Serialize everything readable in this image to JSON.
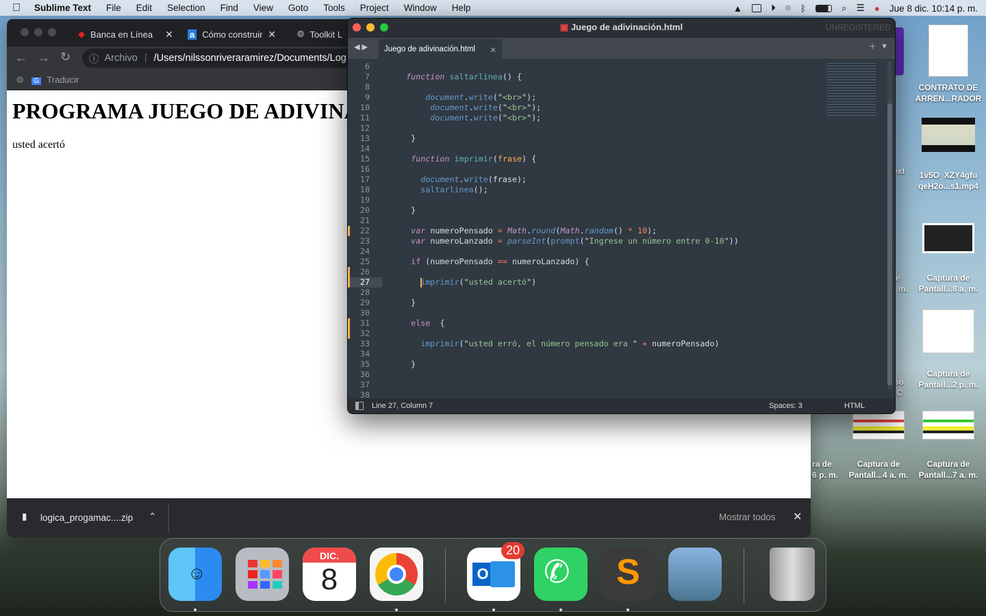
{
  "menubar": {
    "app": "Sublime Text",
    "items": [
      "File",
      "Edit",
      "Selection",
      "Find",
      "View",
      "Goto",
      "Tools",
      "Project",
      "Window",
      "Help"
    ],
    "clock": "Jue 8 dic.  10:14 p. m."
  },
  "chrome": {
    "tabs": [
      {
        "label": "Banca en Línea"
      },
      {
        "label": "Cómo construir u"
      },
      {
        "label": "Toolkit L"
      }
    ],
    "omnibox": {
      "scheme": "Archivo",
      "url": "/Users/nilssonriveraramirez/Documents/Log"
    },
    "bookmarks": [
      "Traducir"
    ],
    "page": {
      "heading": "PROGRAMA JUEGO DE ADIVINA",
      "text": "usted acertó"
    },
    "download": {
      "file": "logica_progamac....zip",
      "show_all": "Mostrar todos"
    }
  },
  "sublime": {
    "title": "Juego de adivinación.html",
    "unregistered": "UNREGISTERED",
    "tab": "Juego de adivinación.html",
    "current_line": 27,
    "status": {
      "position": "Line 27, Column 7",
      "spaces": "Spaces: 3",
      "syntax": "HTML"
    },
    "modified_lines": [
      22,
      26,
      27,
      31,
      32
    ],
    "lines": [
      {
        "n": 6,
        "t": []
      },
      {
        "n": 7,
        "t": [
          [
            "w",
            "   "
          ],
          [
            "k",
            "function"
          ],
          [
            "w",
            " "
          ],
          [
            "f",
            "saltarlinea"
          ],
          [
            "w",
            "() {"
          ]
        ]
      },
      {
        "n": 8,
        "t": []
      },
      {
        "n": 9,
        "t": [
          [
            "w",
            "       "
          ],
          [
            "lib",
            "document"
          ],
          [
            "w",
            "."
          ],
          [
            "m",
            "write"
          ],
          [
            "w",
            "(\""
          ],
          [
            "s",
            "<br>"
          ],
          [
            "w",
            "\");"
          ]
        ]
      },
      {
        "n": 10,
        "t": [
          [
            "w",
            "        "
          ],
          [
            "lib",
            "document"
          ],
          [
            "w",
            "."
          ],
          [
            "m",
            "write"
          ],
          [
            "w",
            "(\""
          ],
          [
            "s",
            "<br>"
          ],
          [
            "w",
            "\");"
          ]
        ]
      },
      {
        "n": 11,
        "t": [
          [
            "w",
            "        "
          ],
          [
            "lib",
            "document"
          ],
          [
            "w",
            "."
          ],
          [
            "m",
            "write"
          ],
          [
            "w",
            "(\""
          ],
          [
            "s",
            "<br>"
          ],
          [
            "w",
            "\");"
          ]
        ]
      },
      {
        "n": 12,
        "t": []
      },
      {
        "n": 13,
        "t": [
          [
            "w",
            "    }"
          ]
        ]
      },
      {
        "n": 14,
        "t": []
      },
      {
        "n": 15,
        "t": [
          [
            "w",
            "    "
          ],
          [
            "k",
            "function"
          ],
          [
            "w",
            " "
          ],
          [
            "f",
            "imprimir"
          ],
          [
            "w",
            "("
          ],
          [
            "p",
            "frase"
          ],
          [
            "w",
            ") {"
          ]
        ]
      },
      {
        "n": 16,
        "t": []
      },
      {
        "n": 17,
        "t": [
          [
            "w",
            "      "
          ],
          [
            "lib",
            "document"
          ],
          [
            "w",
            "."
          ],
          [
            "m",
            "write"
          ],
          [
            "w",
            "(frase);"
          ]
        ]
      },
      {
        "n": 18,
        "t": [
          [
            "w",
            "      "
          ],
          [
            "m",
            "saltarlinea"
          ],
          [
            "w",
            "();"
          ]
        ]
      },
      {
        "n": 19,
        "t": []
      },
      {
        "n": 20,
        "t": [
          [
            "w",
            "    }"
          ]
        ]
      },
      {
        "n": 21,
        "t": []
      },
      {
        "n": 22,
        "t": [
          [
            "w",
            "    "
          ],
          [
            "k",
            "var"
          ],
          [
            "w",
            " numeroPensado "
          ],
          [
            "o",
            "="
          ],
          [
            "w",
            " "
          ],
          [
            "k",
            "Math"
          ],
          [
            "w",
            "."
          ],
          [
            "lib",
            "round"
          ],
          [
            "w",
            "("
          ],
          [
            "k",
            "Math"
          ],
          [
            "w",
            "."
          ],
          [
            "lib",
            "random"
          ],
          [
            "w",
            "() "
          ],
          [
            "o",
            "*"
          ],
          [
            "w",
            " "
          ],
          [
            "n",
            "10"
          ],
          [
            "w",
            ");"
          ]
        ]
      },
      {
        "n": 23,
        "t": [
          [
            "w",
            "    "
          ],
          [
            "k",
            "var"
          ],
          [
            "w",
            " numeroLanzado "
          ],
          [
            "o",
            "="
          ],
          [
            "w",
            " "
          ],
          [
            "lib",
            "parseInt"
          ],
          [
            "w",
            "("
          ],
          [
            "m",
            "prompt"
          ],
          [
            "w",
            "(\""
          ],
          [
            "s",
            "Ingrese un número entre 0-10"
          ],
          [
            "w",
            "\"))"
          ]
        ]
      },
      {
        "n": 24,
        "t": []
      },
      {
        "n": 25,
        "t": [
          [
            "w",
            "    "
          ],
          [
            "kn",
            "if"
          ],
          [
            "w",
            " (numeroPensado "
          ],
          [
            "o",
            "=="
          ],
          [
            "w",
            " numeroLanzado) {"
          ]
        ]
      },
      {
        "n": 26,
        "t": []
      },
      {
        "n": 27,
        "t": [
          [
            "w",
            "      "
          ],
          [
            "m",
            "imprimir"
          ],
          [
            "w",
            "(\""
          ],
          [
            "s",
            "usted acertó"
          ],
          [
            "w",
            "\")"
          ]
        ]
      },
      {
        "n": 28,
        "t": []
      },
      {
        "n": 29,
        "t": [
          [
            "w",
            "    }"
          ]
        ]
      },
      {
        "n": 30,
        "t": []
      },
      {
        "n": 31,
        "t": [
          [
            "w",
            "    "
          ],
          [
            "kn",
            "else"
          ],
          [
            "w",
            "  {"
          ]
        ]
      },
      {
        "n": 32,
        "t": []
      },
      {
        "n": 33,
        "t": [
          [
            "w",
            "      "
          ],
          [
            "m",
            "imprimir"
          ],
          [
            "w",
            "(\""
          ],
          [
            "s",
            "usted erró, el número pensado era "
          ],
          [
            "w",
            "\" "
          ],
          [
            "o",
            "+"
          ],
          [
            "w",
            " numeroPensado)"
          ]
        ]
      },
      {
        "n": 34,
        "t": []
      },
      {
        "n": 35,
        "t": [
          [
            "w",
            "    }"
          ]
        ]
      },
      {
        "n": 36,
        "t": []
      },
      {
        "n": 37,
        "t": []
      },
      {
        "n": 38,
        "t": []
      }
    ]
  },
  "desktop": {
    "icons": [
      {
        "label": "CONTRATO DE ARREN...RADOR"
      },
      {
        "label": "1v5O_XZY4gfu qeH2o...s1.mp4"
      },
      {
        "label": "Captura de Pantall...8 a. m."
      },
      {
        "label": "Captura de Pantall...2 p. m."
      },
      {
        "label": "Captura de Pantall...4 a. m."
      },
      {
        "label": "Captura de Pantall...7 a. m."
      }
    ],
    "partial": [
      "ext",
      "e",
      "m.",
      "so",
      "IC",
      "ra de",
      "6 p. m."
    ]
  },
  "dock": {
    "apps": [
      "Finder",
      "Launchpad",
      "Calendar",
      "Google Chrome",
      "Microsoft Outlook",
      "WhatsApp",
      "Sublime Text",
      "Preview",
      "Trash"
    ],
    "calendar_month": "DIC.",
    "calendar_day": "8",
    "outlook_badge": "20"
  }
}
